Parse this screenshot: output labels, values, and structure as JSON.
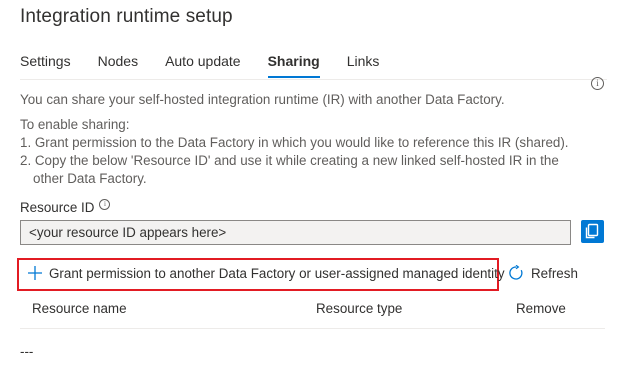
{
  "header": {
    "title": "Integration runtime setup"
  },
  "tabs": [
    {
      "label": "Settings",
      "active": false
    },
    {
      "label": "Nodes",
      "active": false
    },
    {
      "label": "Auto update",
      "active": false
    },
    {
      "label": "Sharing",
      "active": true
    },
    {
      "label": "Links",
      "active": false
    }
  ],
  "sharing": {
    "intro": "You can share your self-hosted integration runtime (IR) with another Data Factory.",
    "steps_heading": "To enable sharing:",
    "step1": "1. Grant permission to the Data Factory in which you would like to reference this IR (shared).",
    "step2_line1": "2. Copy the below 'Resource ID' and use it while creating a new linked self-hosted IR in the",
    "step2_line2": "other Data Factory.",
    "resource_label": "Resource ID",
    "resource_value": "<your resource ID appears here>"
  },
  "actions": {
    "grant_label": "Grant permission to another Data Factory or user-assigned managed identity",
    "refresh_label": "Refresh"
  },
  "table": {
    "columns": [
      "Resource name",
      "Resource type",
      "Remove"
    ],
    "empty_text": "---"
  },
  "icons": {
    "info": "info-icon",
    "copy": "copy-icon",
    "add": "plus-icon",
    "refresh": "refresh-icon"
  },
  "colors": {
    "accent": "#0078d4",
    "highlight_border": "#e21b23"
  }
}
